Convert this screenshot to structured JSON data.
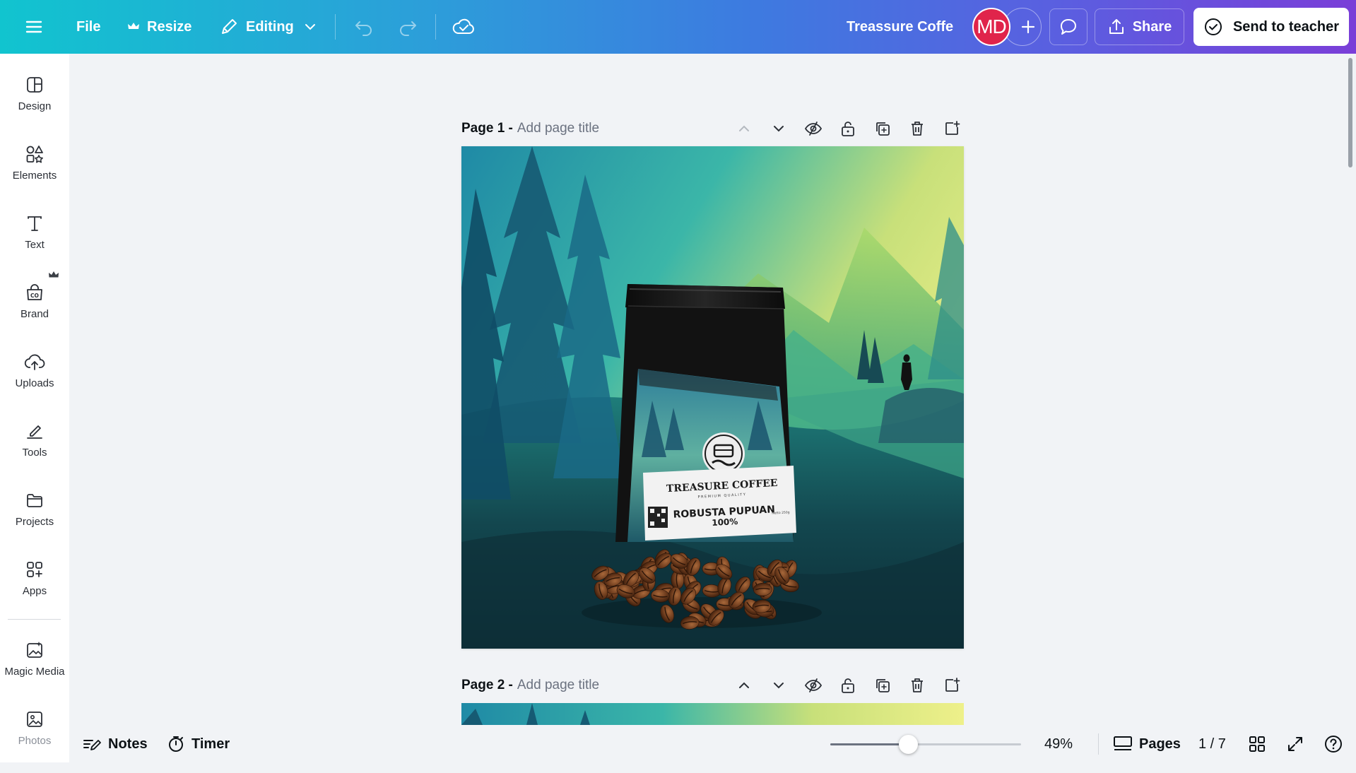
{
  "topbar": {
    "file_label": "File",
    "resize_label": "Resize",
    "editing_label": "Editing",
    "doc_title": "Treassure Coffe",
    "avatar_initials": "MD",
    "share_label": "Share",
    "send_label": "Send to teacher"
  },
  "sidebar": {
    "items": [
      {
        "label": "Design",
        "icon": "design-icon"
      },
      {
        "label": "Elements",
        "icon": "elements-icon"
      },
      {
        "label": "Text",
        "icon": "text-icon"
      },
      {
        "label": "Brand",
        "icon": "brand-icon"
      },
      {
        "label": "Uploads",
        "icon": "uploads-icon"
      },
      {
        "label": "Tools",
        "icon": "tools-icon"
      },
      {
        "label": "Projects",
        "icon": "projects-icon"
      },
      {
        "label": "Apps",
        "icon": "apps-icon"
      },
      {
        "label": "Magic Media",
        "icon": "magic-media-icon"
      },
      {
        "label": "Photos",
        "icon": "photos-icon"
      }
    ]
  },
  "pages": [
    {
      "number_label": "Page 1 -",
      "title_placeholder": "Add page title"
    },
    {
      "number_label": "Page 2 -",
      "title_placeholder": "Add page title"
    }
  ],
  "design": {
    "brand_name": "TREASURE COFFEE",
    "brand_tagline": "PREMIUM QUALITY",
    "product_line1": "ROBUSTA PUPUAN",
    "product_line2": "100%",
    "net_weight": "Netto 250g"
  },
  "bottombar": {
    "notes_label": "Notes",
    "timer_label": "Timer",
    "zoom_value": 49,
    "zoom_label": "49%",
    "pages_label": "Pages",
    "page_counter": "1 / 7"
  },
  "colors": {
    "accent_start": "#11c4cf",
    "accent_end": "#7a3ed8",
    "avatar": "#e0244b"
  }
}
